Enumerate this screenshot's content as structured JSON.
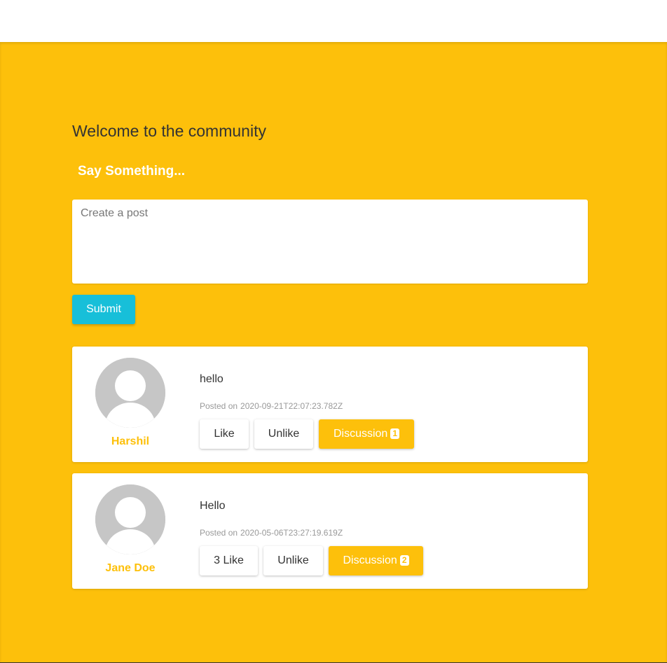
{
  "main": {
    "title": "Welcome to the community",
    "prompt": "Say Something...",
    "post_input": {
      "placeholder": "Create a post",
      "value": ""
    },
    "submit_label": "Submit"
  },
  "posts": [
    {
      "author": "Harshil",
      "text": "hello",
      "posted_prefix": "Posted on",
      "date": "2020-09-21T22:07:23.782Z",
      "like_label": "Like",
      "unlike_label": "Unlike",
      "discussion_label": "Discussion",
      "discussion_count": "1",
      "avatar_icon": "default-user-avatar-icon"
    },
    {
      "author": "Jane Doe",
      "text": "Hello",
      "posted_prefix": "Posted on",
      "date": "2020-05-06T23:27:19.619Z",
      "like_label": "3 Like",
      "unlike_label": "Unlike",
      "discussion_label": "Discussion",
      "discussion_count": "2",
      "avatar_icon": "default-user-avatar-icon"
    }
  ],
  "colors": {
    "background": "#fdc00b",
    "accent": "#fdc00b",
    "submit": "#17bfd9",
    "card": "#ffffff"
  }
}
